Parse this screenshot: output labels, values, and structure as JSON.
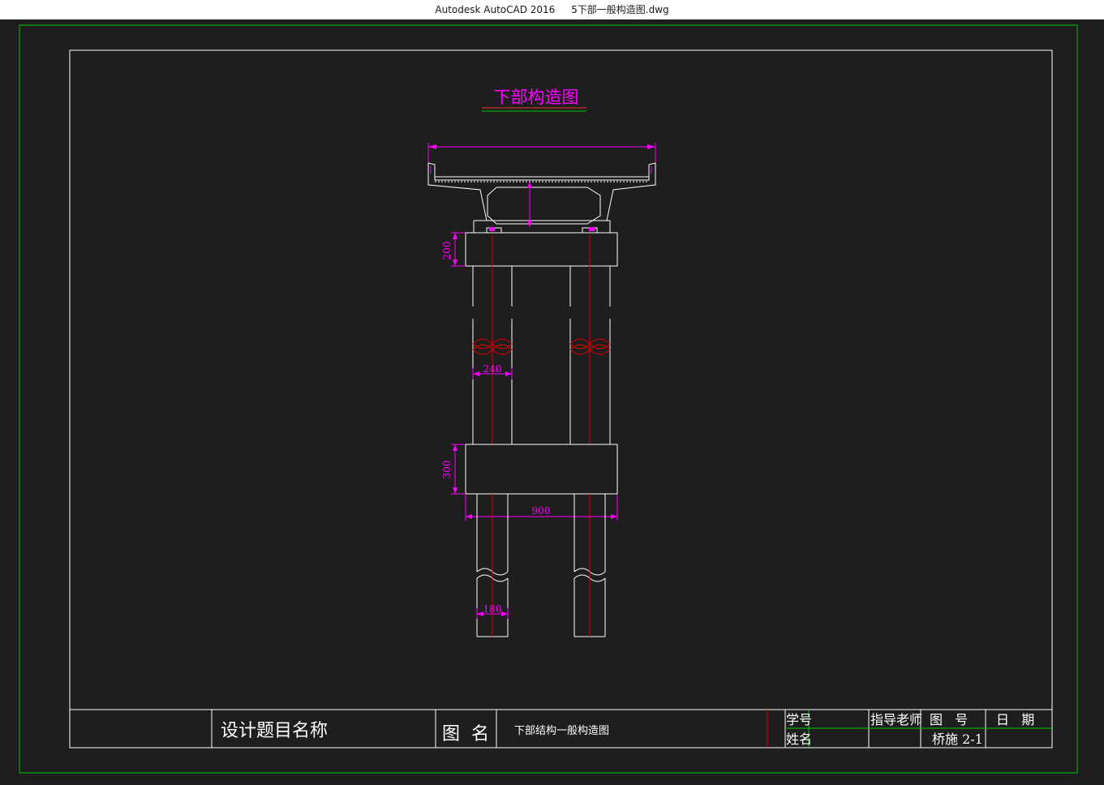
{
  "window": {
    "app_title": "Autodesk AutoCAD 2016",
    "file_name": "5下部一般构造图.dwg"
  },
  "drawing": {
    "title": "下部构造图",
    "dimensions": {
      "cap_beam_height": "200",
      "column_diameter": "240",
      "tie_beam_height": "300",
      "pile_spacing_width": "900",
      "pile_diameter": "180"
    }
  },
  "title_block": {
    "project_label": "设计题目名称",
    "drawing_name_label": "图  名",
    "drawing_name_value": "下部结构一般构造图",
    "student_id_label": "学号",
    "name_label": "姓名",
    "advisor_label": "指导老师",
    "drawing_no_label": "图   号",
    "drawing_no_value": "桥施 2-1",
    "date_label": "日   期"
  },
  "colors": {
    "background": "#1e1e1e",
    "geometry": "#ffffff",
    "frame_green": "#00c800",
    "dimension_magenta": "#ff00ff",
    "centerline_red": "#e00000"
  }
}
